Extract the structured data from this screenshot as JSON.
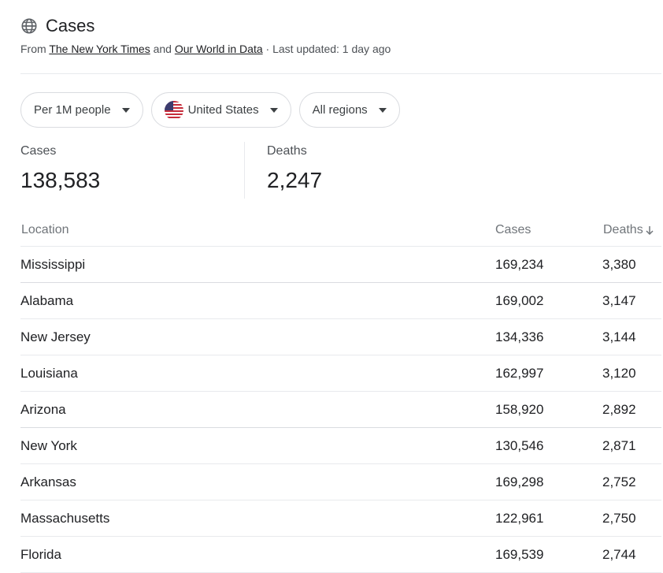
{
  "header": {
    "title": "Cases",
    "source_prefix": "From",
    "source_1": "The New York Times",
    "source_and": "and",
    "source_2": "Our World in Data",
    "updated": "· Last updated: 1 day ago"
  },
  "filters": {
    "metric": "Per 1M people",
    "country": "United States",
    "region": "All regions"
  },
  "summary": {
    "cases_label": "Cases",
    "cases_value": "138,583",
    "deaths_label": "Deaths",
    "deaths_value": "2,247"
  },
  "table": {
    "columns": [
      "Location",
      "Cases",
      "Deaths"
    ],
    "sorted_by": "Deaths",
    "sort_direction": "descending",
    "rows": [
      {
        "location": "Mississippi",
        "cases": "169,234",
        "deaths": "3,380"
      },
      {
        "location": "Alabama",
        "cases": "169,002",
        "deaths": "3,147"
      },
      {
        "location": "New Jersey",
        "cases": "134,336",
        "deaths": "3,144"
      },
      {
        "location": "Louisiana",
        "cases": "162,997",
        "deaths": "3,120"
      },
      {
        "location": "Arizona",
        "cases": "158,920",
        "deaths": "2,892"
      },
      {
        "location": "New York",
        "cases": "130,546",
        "deaths": "2,871"
      },
      {
        "location": "Arkansas",
        "cases": "169,298",
        "deaths": "2,752"
      },
      {
        "location": "Massachusetts",
        "cases": "122,961",
        "deaths": "2,750"
      },
      {
        "location": "Florida",
        "cases": "169,539",
        "deaths": "2,744"
      }
    ]
  },
  "icons": {
    "title_icon": "globe-icon",
    "country_icon": "us-flag-icon",
    "dropdown_icon": "caret-down-icon",
    "sort_icon": "arrow-down-icon"
  },
  "colors": {
    "text": "#202124",
    "secondary": "#4d5156",
    "muted": "#70757a",
    "border": "#dadce0",
    "divider": "#e8eaed"
  }
}
